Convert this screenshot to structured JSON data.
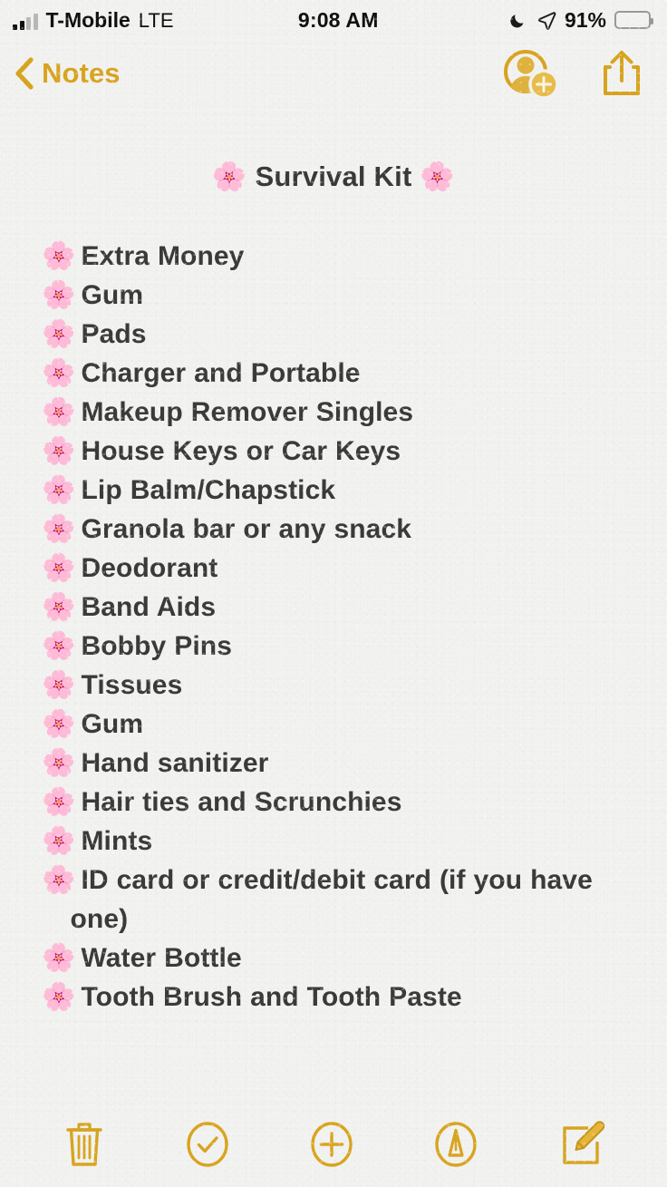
{
  "status_bar": {
    "carrier": "T-Mobile",
    "radio_type": "LTE",
    "time": "9:08 AM",
    "battery_percent": "91%",
    "battery_level": 91,
    "battery_color": "#f5cb43",
    "icons": [
      "signal-bars-icon",
      "moon-icon",
      "location-arrow-icon",
      "battery-icon"
    ]
  },
  "nav_bar": {
    "back_label": "Notes",
    "back_icon": "chevron-left-icon",
    "accent_color": "#d9a520",
    "actions": [
      {
        "name": "add-people-button",
        "icon": "person-add-icon"
      },
      {
        "name": "share-button",
        "icon": "share-icon"
      }
    ]
  },
  "note": {
    "title": "🌸 Survival Kit 🌸",
    "title_text": "Survival Kit",
    "bullet_emoji": "🌸",
    "text_color": "#3b3b3b",
    "items": [
      "Extra Money",
      "Gum",
      "Pads",
      "Charger and Portable",
      "Makeup Remover Singles",
      "House Keys or Car Keys",
      "Lip Balm/Chapstick",
      "Granola bar or any snack",
      "Deodorant",
      "Band Aids",
      "Bobby Pins",
      "Tissues",
      "Gum",
      "Hand sanitizer",
      "Hair ties and Scrunchies",
      "Mints",
      "ID card or credit/debit card (if you have one)",
      "Water Bottle",
      "Tooth Brush and Tooth Paste"
    ]
  },
  "toolbar": {
    "accent_color": "#d9a520",
    "buttons": [
      {
        "name": "delete-button",
        "icon": "trash-icon"
      },
      {
        "name": "checklist-button",
        "icon": "check-circle-icon"
      },
      {
        "name": "add-button",
        "icon": "plus-circle-icon"
      },
      {
        "name": "markup-button",
        "icon": "markup-pen-circle-icon"
      },
      {
        "name": "compose-button",
        "icon": "compose-icon"
      }
    ]
  }
}
